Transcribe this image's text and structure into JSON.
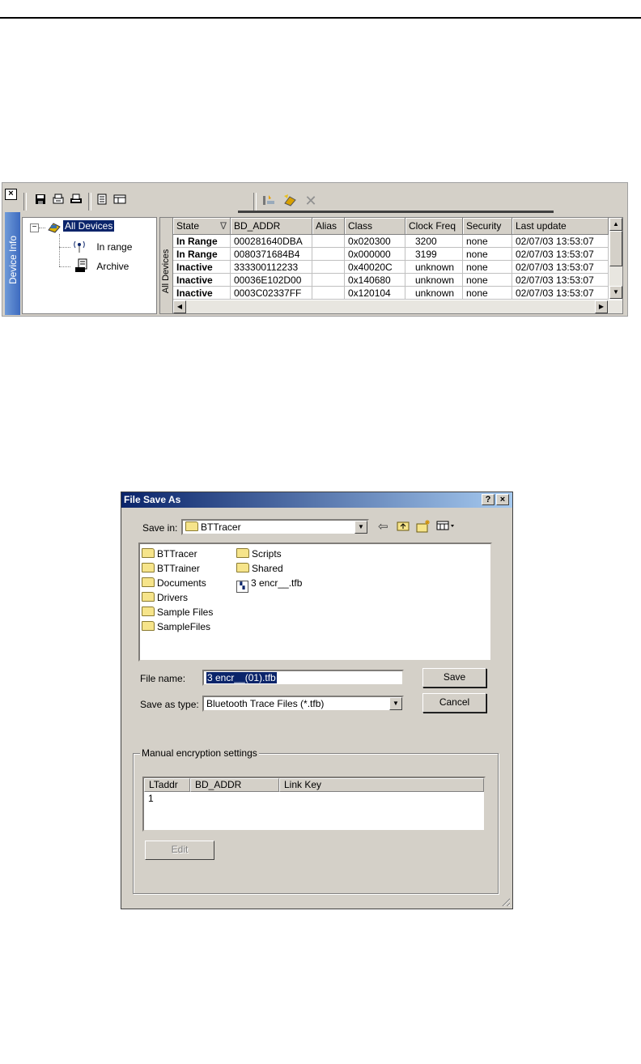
{
  "device_panel": {
    "close_glyph": "×",
    "side_tab_label": "Device Info",
    "toolbar": {
      "icons": [
        "save-icon",
        "print-preview-icon",
        "print-icon",
        "page-icon",
        "grid-icon",
        "pipe-connect-icon",
        "device-add-icon",
        "delete-icon"
      ]
    },
    "tree": {
      "root": "All Devices",
      "children": [
        "In range",
        "Archive"
      ]
    },
    "vertical_tab_label": "All Devices",
    "table": {
      "columns": [
        "State",
        "BD_ADDR",
        "Alias",
        "Class",
        "Clock Freq",
        "Security",
        "Last update"
      ],
      "sort_glyph": "∇",
      "rows": [
        [
          "In Range",
          "000281640DBA",
          "",
          "0x020300",
          "3200",
          "none",
          "02/07/03 13:53:07"
        ],
        [
          "In Range",
          "0080371684B4",
          "",
          "0x000000",
          "3199",
          "none",
          "02/07/03 13:53:07"
        ],
        [
          "Inactive",
          "333300112233",
          "",
          "0x40020C",
          "unknown",
          "none",
          "02/07/03 13:53:07"
        ],
        [
          "Inactive",
          "00036E102D00",
          "",
          "0x140680",
          "unknown",
          "none",
          "02/07/03 13:53:07"
        ],
        [
          "Inactive",
          "0003C02337FF",
          "",
          "0x120104",
          "unknown",
          "none",
          "02/07/03 13:53:07"
        ]
      ]
    }
  },
  "dialog": {
    "title": "File Save As",
    "help_glyph": "?",
    "close_glyph": "×",
    "save_in_label": "Save in:",
    "save_in_value": "BTTracer",
    "files_col1": [
      "BTTracer",
      "BTTrainer",
      "Documents",
      "Drivers",
      "Sample Files",
      "SampleFiles"
    ],
    "files_col2": [
      "Scripts",
      "Shared"
    ],
    "trace_file": "3 encr__.tfb",
    "file_name_label": "File name:",
    "file_name_value": "3 encr__(01).tfb",
    "save_type_label": "Save as type:",
    "save_type_value": "Bluetooth Trace Files (*.tfb)",
    "save_button": "Save",
    "cancel_button": "Cancel",
    "group_label": "Manual encryption settings",
    "key_columns": [
      "LTaddr",
      "BD_ADDR",
      "Link Key"
    ],
    "key_rows": [
      "1"
    ],
    "edit_button": "Edit"
  }
}
